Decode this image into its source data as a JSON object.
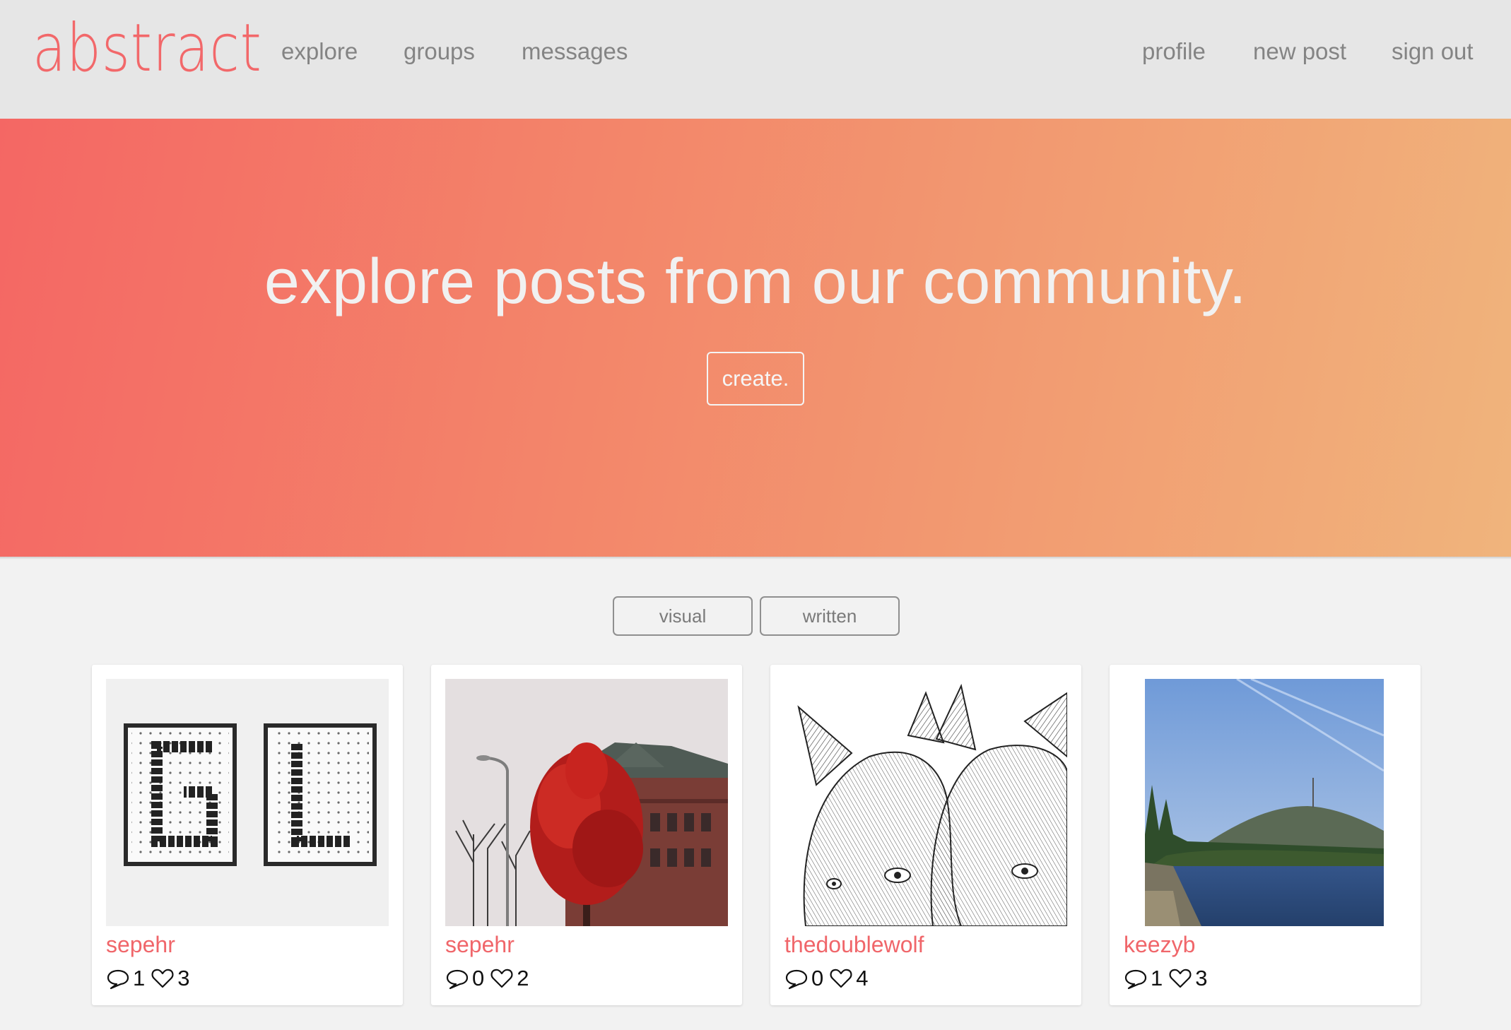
{
  "navbar": {
    "logo": "abstract",
    "left_links": [
      "explore",
      "groups",
      "messages"
    ],
    "right_links": [
      "profile",
      "new post",
      "sign out"
    ]
  },
  "hero": {
    "title": "explore posts from our community.",
    "button": "create."
  },
  "filters": [
    "visual",
    "written"
  ],
  "posts": [
    {
      "user": "sepehr",
      "comments": "1",
      "likes": "3",
      "image": "GL pegboard letters photo"
    },
    {
      "user": "sepehr",
      "comments": "0",
      "likes": "2",
      "image": "red tree and brick building photo"
    },
    {
      "user": "thedoublewolf",
      "comments": "0",
      "likes": "4",
      "image": "two-headed wolf ink drawing"
    },
    {
      "user": "keezyb",
      "comments": "1",
      "likes": "3",
      "image": "lake and mountain photo"
    }
  ],
  "icons": {
    "comment": "comment-icon",
    "like": "heart-icon"
  },
  "colors": {
    "accent": "#f2686a",
    "hero_start": "#f46764",
    "hero_end": "#f0b47c",
    "nav_bg": "#e6e6e6"
  }
}
